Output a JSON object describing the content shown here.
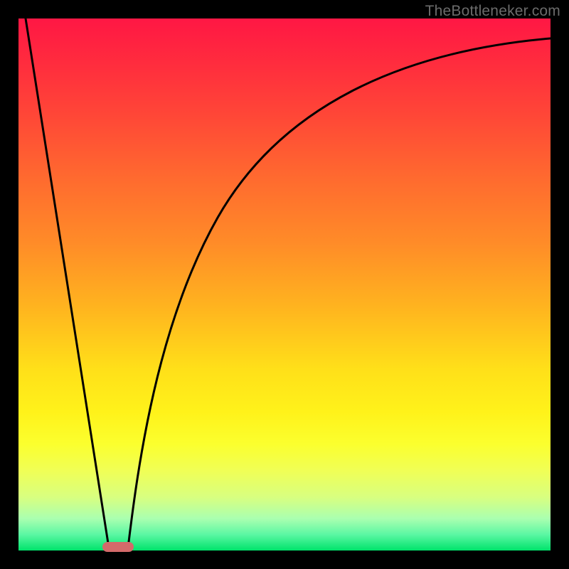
{
  "watermark": "TheBottleneker.com",
  "chart_data": {
    "type": "line",
    "title": "",
    "xlabel": "",
    "ylabel": "",
    "xlim": [
      0,
      100
    ],
    "ylim": [
      0,
      100
    ],
    "note": "Axes are implicit (no tick labels rendered). Values estimated as 748-unit canvas coords, origin top-left; y increases downward.",
    "series": [
      {
        "name": "left-line",
        "type": "line",
        "points_748": [
          [
            10,
            0
          ],
          [
            127,
            744
          ]
        ]
      },
      {
        "name": "right-curve",
        "type": "curve",
        "cubic_beziers_748": [
          {
            "p0": [
              154,
              744
            ],
            "c1": [
              168,
              628
            ],
            "c2": [
              195,
              430
            ],
            "p1": [
              280,
              280
            ]
          },
          {
            "p0": [
              280,
              280
            ],
            "c1": [
              370,
              122
            ],
            "c2": [
              540,
              46
            ],
            "p1": [
              748,
              28
            ]
          }
        ]
      }
    ],
    "marker": {
      "name": "bottom-marker",
      "shape": "rounded-rect",
      "fill": "#d46a6a",
      "rect_748": {
        "x": 118,
        "y": 736,
        "w": 44,
        "h": 14,
        "rx": 7
      }
    },
    "background": {
      "type": "vertical-gradient",
      "stops": [
        {
          "pos": 0.0,
          "color": "#ff1744"
        },
        {
          "pos": 0.5,
          "color": "#ffb31f"
        },
        {
          "pos": 0.75,
          "color": "#fff21a"
        },
        {
          "pos": 1.0,
          "color": "#00e36b"
        }
      ]
    }
  }
}
